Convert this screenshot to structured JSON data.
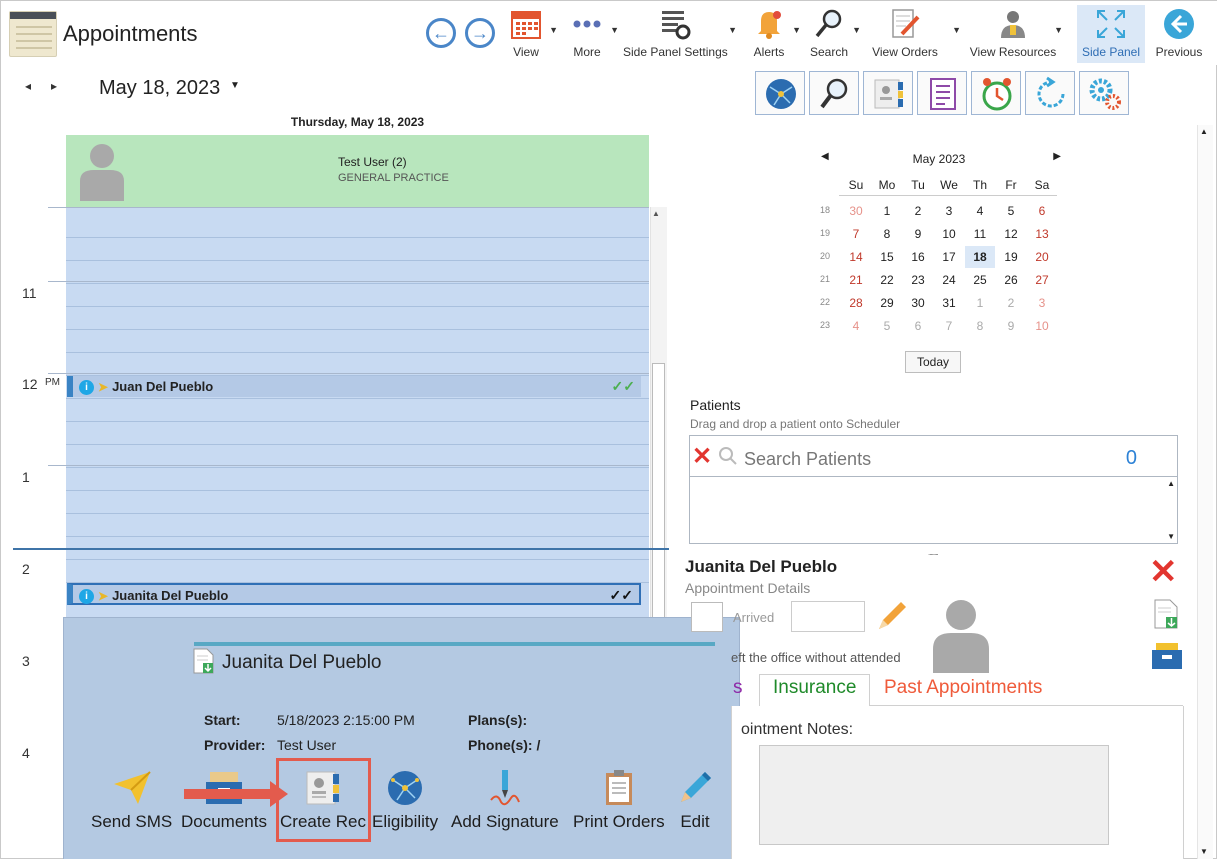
{
  "header": {
    "title": "Appointments",
    "toolbar": [
      {
        "id": "view",
        "label": "View"
      },
      {
        "id": "more",
        "label": "More"
      },
      {
        "id": "side-panel-settings",
        "label": "Side Panel Settings"
      },
      {
        "id": "alerts",
        "label": "Alerts"
      },
      {
        "id": "search",
        "label": "Search"
      },
      {
        "id": "view-orders",
        "label": "View Orders"
      },
      {
        "id": "view-resources",
        "label": "View Resources"
      },
      {
        "id": "side-panel",
        "label": "Side Panel"
      },
      {
        "id": "previous",
        "label": "Previous"
      }
    ]
  },
  "scheduler": {
    "date": "May 18, 2023",
    "day_heading": "Thursday, May 18, 2023",
    "provider_name": "Test User (2)",
    "provider_specialty": "GENERAL PRACTICE",
    "hours": [
      "11",
      "12",
      "1",
      "2",
      "3",
      "4"
    ],
    "pm": "PM",
    "appointments": [
      {
        "name": "Juan Del Pueblo",
        "status": "✓✓",
        "status_color": "#4caf50"
      },
      {
        "name": "Juanita Del Pueblo",
        "status": "✓✓",
        "status_color": "#111111"
      }
    ]
  },
  "popup": {
    "name": "Juanita Del Pueblo",
    "start_label": "Start:",
    "start_value": "5/18/2023 2:15:00 PM",
    "provider_label": "Provider:",
    "provider_value": "Test User",
    "plans_label": "Plans(s):",
    "phone_label": "Phone(s): /",
    "actions": [
      "Send SMS",
      "Documents",
      "Create Rec",
      "Eligibility",
      "Add Signature",
      "Print Orders",
      "Edit"
    ]
  },
  "calendar": {
    "month": "May 2023",
    "dow": [
      "Su",
      "Mo",
      "Tu",
      "We",
      "Th",
      "Fr",
      "Sa"
    ],
    "weeks": [
      {
        "wk": "18",
        "days": [
          "30",
          "1",
          "2",
          "3",
          "4",
          "5",
          "6"
        ]
      },
      {
        "wk": "19",
        "days": [
          "7",
          "8",
          "9",
          "10",
          "11",
          "12",
          "13"
        ]
      },
      {
        "wk": "20",
        "days": [
          "14",
          "15",
          "16",
          "17",
          "18",
          "19",
          "20"
        ]
      },
      {
        "wk": "21",
        "days": [
          "21",
          "22",
          "23",
          "24",
          "25",
          "26",
          "27"
        ]
      },
      {
        "wk": "22",
        "days": [
          "28",
          "29",
          "30",
          "31",
          "1",
          "2",
          "3"
        ]
      },
      {
        "wk": "23",
        "days": [
          "4",
          "5",
          "6",
          "7",
          "8",
          "9",
          "10"
        ]
      }
    ],
    "today_label": "Today"
  },
  "patients": {
    "label": "Patients",
    "hint": "Drag and drop a patient onto Scheduler",
    "search_placeholder": "Search Patients",
    "count": "0"
  },
  "details": {
    "name": "Juanita Del Pueblo",
    "subtitle": "Appointment Details",
    "arrived_label": "Arrived",
    "left_office_text": "eft the office without attended",
    "tabs": [
      {
        "label": "s",
        "color": "#8e2aa8"
      },
      {
        "label": "Insurance",
        "color": "#1f8a2a"
      },
      {
        "label": "Past Appointments",
        "color": "#ef5b3b"
      }
    ],
    "notes_label": "ointment Notes:"
  },
  "colors": {
    "accent": "#2e6db4",
    "provider_bg": "#b8e6bd",
    "grid_bg": "#c8daf2",
    "popup_bg": "#b4c9e2",
    "highlight": "#e35b4d"
  }
}
